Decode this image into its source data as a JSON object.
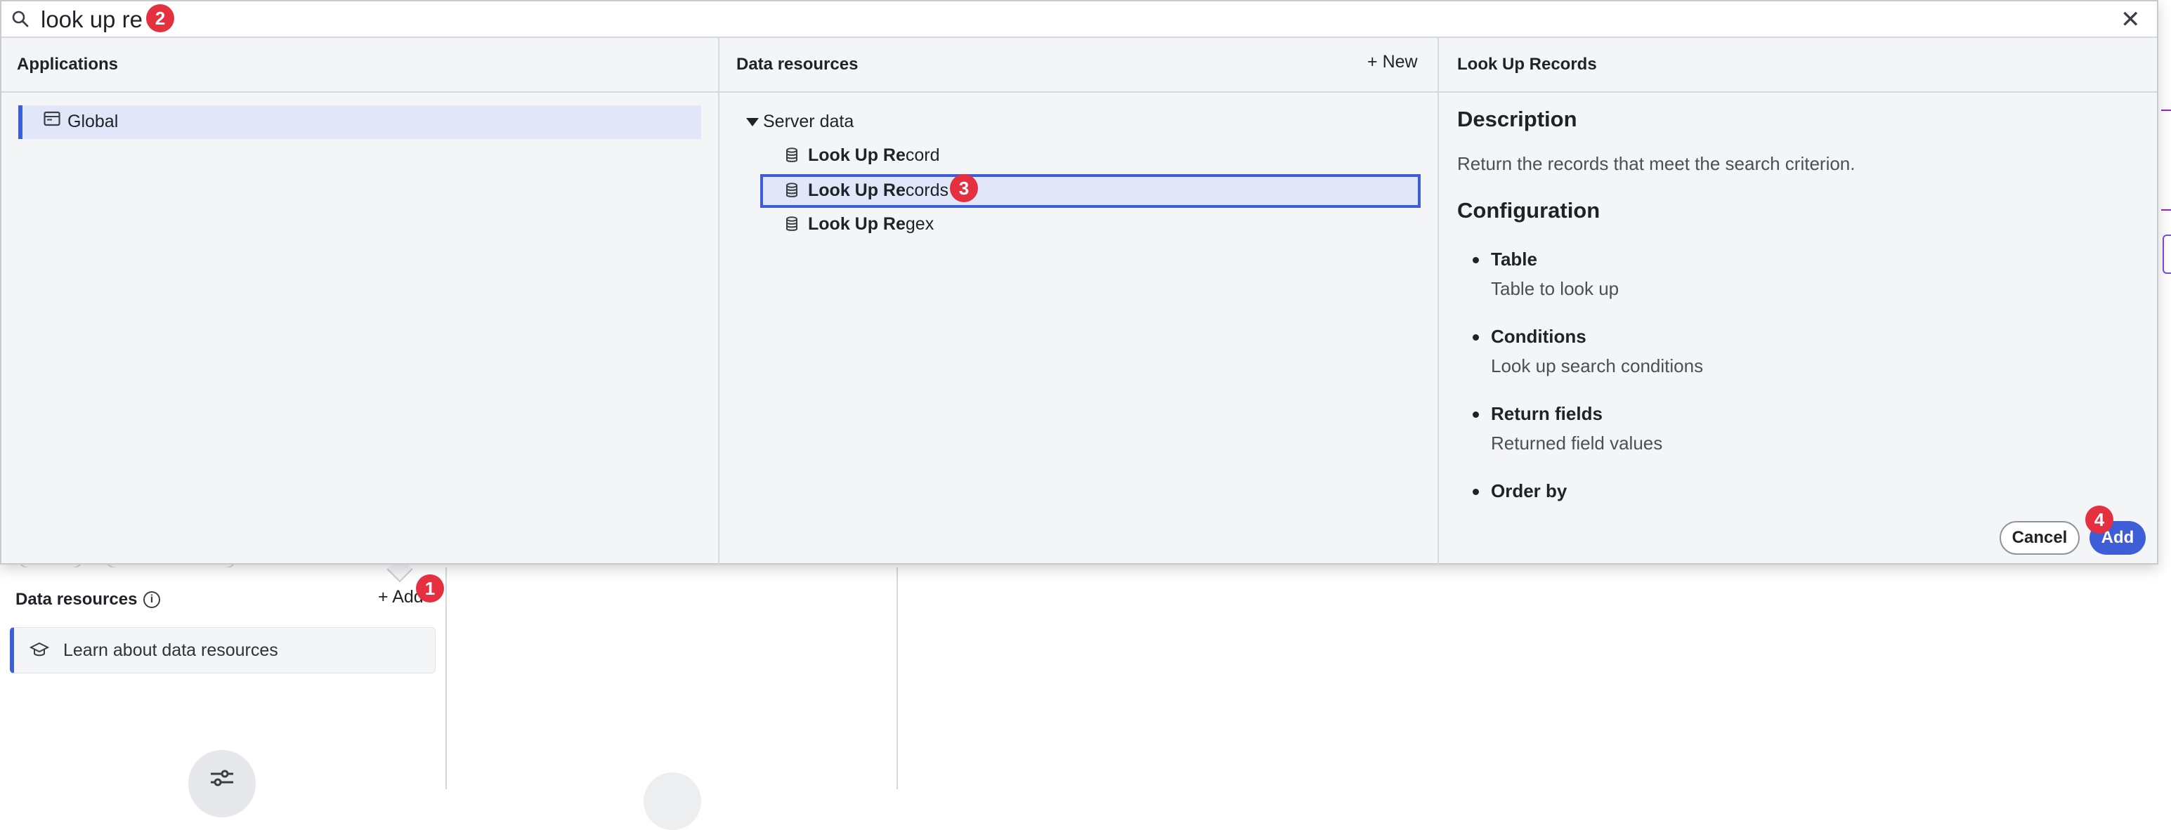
{
  "search": {
    "value": "look up re"
  },
  "applications": {
    "title": "Applications",
    "items": [
      {
        "label": "Global",
        "icon": "window-icon",
        "selected": true
      }
    ]
  },
  "data_resources_panel": {
    "title": "Data resources",
    "new_label": "New",
    "tree": {
      "root_label": "Server data",
      "items": [
        {
          "match": "Look Up Re",
          "rest": "cord",
          "icon": "database-icon",
          "selected": false
        },
        {
          "match": "Look Up Re",
          "rest": "cords",
          "icon": "database-icon",
          "selected": true
        },
        {
          "match": "Look Up Re",
          "rest": "gex",
          "icon": "database-icon",
          "selected": false
        }
      ]
    }
  },
  "details": {
    "title": "Look Up Records",
    "description_heading": "Description",
    "description": "Return the records that meet the search criterion.",
    "configuration_heading": "Configuration",
    "configuration": [
      {
        "name": "Table",
        "desc": "Table to look up"
      },
      {
        "name": "Conditions",
        "desc": "Look up search conditions"
      },
      {
        "name": "Return fields",
        "desc": "Returned field values"
      },
      {
        "name": "Order by",
        "desc": ""
      }
    ],
    "cancel_label": "Cancel",
    "add_label": "Add"
  },
  "background": {
    "data_resources_title": "Data resources",
    "add_label": "Add",
    "learn_label": "Learn about data resources"
  },
  "badges": [
    "1",
    "2",
    "3",
    "4"
  ],
  "colors": {
    "accent": "#3e5ed8",
    "badge": "#e5303f",
    "selection_bg": "#e1e7f8"
  }
}
